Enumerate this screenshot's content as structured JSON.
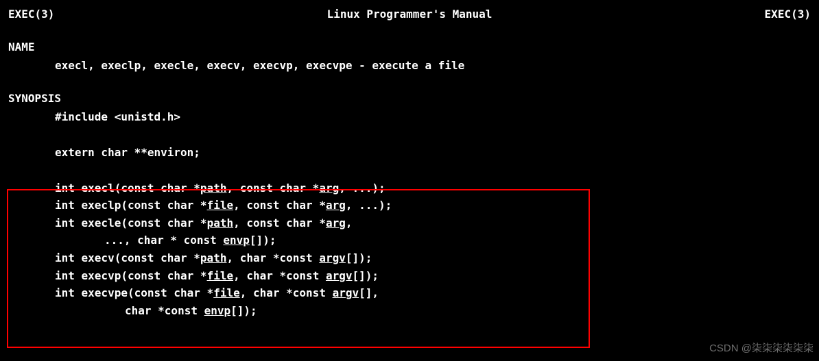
{
  "header": {
    "left": "EXEC(3)",
    "center": "Linux Programmer's Manual",
    "right": "EXEC(3)"
  },
  "sections": {
    "name": {
      "title": "NAME",
      "content": "execl, execlp, execle, execv, execvp, execvpe - execute a file"
    },
    "synopsis": {
      "title": "SYNOPSIS",
      "include": "#include <unistd.h>",
      "extern": "extern char **environ;",
      "funcs": {
        "execl": {
          "pre": "int execl(const char *",
          "p1": "path",
          "mid": ", const char *",
          "p2": "arg",
          "post": ", ...);"
        },
        "execlp": {
          "pre": "int execlp(const char *",
          "p1": "file",
          "mid": ", const char *",
          "p2": "arg",
          "post": ", ...);"
        },
        "execle_l1": {
          "pre": "int execle(const char *",
          "p1": "path",
          "mid": ", const char *",
          "p2": "arg",
          "post": ","
        },
        "execle_l2": {
          "pre": "..., char * const ",
          "p1": "envp",
          "post": "[]);"
        },
        "execv": {
          "pre": "int execv(const char *",
          "p1": "path",
          "mid": ", char *const ",
          "p2": "argv",
          "post": "[]);"
        },
        "execvp": {
          "pre": "int execvp(const char *",
          "p1": "file",
          "mid": ", char *const ",
          "p2": "argv",
          "post": "[]);"
        },
        "execvpe_l1": {
          "pre": "int execvpe(const char *",
          "p1": "file",
          "mid": ", char *const ",
          "p2": "argv",
          "post": "[],"
        },
        "execvpe_l2": {
          "pre": "char *const ",
          "p1": "envp",
          "post": "[]);"
        }
      }
    }
  },
  "watermark": "CSDN @柒柒柒柒柒柒"
}
